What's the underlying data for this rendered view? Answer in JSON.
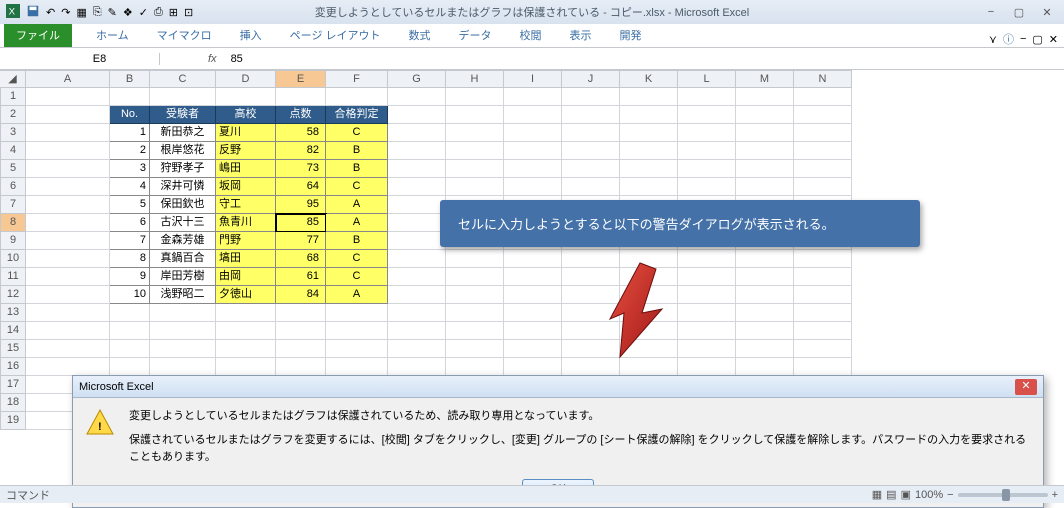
{
  "title": "変更しようとしているセルまたはグラフは保護されている - コピー.xlsx - Microsoft Excel",
  "ribbon": {
    "file": "ファイル",
    "home": "ホーム",
    "mymacro": "マイマクロ",
    "insert": "挿入",
    "layout": "ページ レイアウト",
    "formula": "数式",
    "data": "データ",
    "review": "校閲",
    "view": "表示",
    "dev": "開発"
  },
  "namebox": "E8",
  "formula": "85",
  "cols": [
    "A",
    "B",
    "C",
    "D",
    "E",
    "F",
    "G",
    "H",
    "I",
    "J",
    "K",
    "L",
    "M",
    "N"
  ],
  "hdr": {
    "no": "No.",
    "examinee": "受験者",
    "school": "高校",
    "score": "点数",
    "grade": "合格判定"
  },
  "rows": [
    {
      "n": 1,
      "name": "新田恭之",
      "school": "夏川",
      "score": 58,
      "grade": "C"
    },
    {
      "n": 2,
      "name": "根岸悠花",
      "school": "反野",
      "score": 82,
      "grade": "B"
    },
    {
      "n": 3,
      "name": "狩野孝子",
      "school": "嶋田",
      "score": 73,
      "grade": "B"
    },
    {
      "n": 4,
      "name": "深井可憐",
      "school": "坂岡",
      "score": 64,
      "grade": "C"
    },
    {
      "n": 5,
      "name": "保田欽也",
      "school": "守工",
      "score": 95,
      "grade": "A"
    },
    {
      "n": 6,
      "name": "古沢十三",
      "school": "魚青川",
      "score": 85,
      "grade": "A"
    },
    {
      "n": 7,
      "name": "金森芳雄",
      "school": "門野",
      "score": 77,
      "grade": "B"
    },
    {
      "n": 8,
      "name": "真鍋百合",
      "school": "塙田",
      "score": 68,
      "grade": "C"
    },
    {
      "n": 9,
      "name": "岸田芳樹",
      "school": "由岡",
      "score": 61,
      "grade": "C"
    },
    {
      "n": 10,
      "name": "浅野昭二",
      "school": "夕徳山",
      "score": 84,
      "grade": "A"
    }
  ],
  "callout": "セルに入力しようとすると以下の警告ダイアログが表示される。",
  "dlg": {
    "title": "Microsoft Excel",
    "line1": "変更しようとしているセルまたはグラフは保護されているため、読み取り専用となっています。",
    "line2": "保護されているセルまたはグラフを変更するには、[校閲] タブをクリックし、[変更] グループの [シート保護の解除] をクリックして保護を解除します。パスワードの入力を要求されることもあります。",
    "ok": "OK"
  },
  "status": "コマンド",
  "zoom": "100%"
}
